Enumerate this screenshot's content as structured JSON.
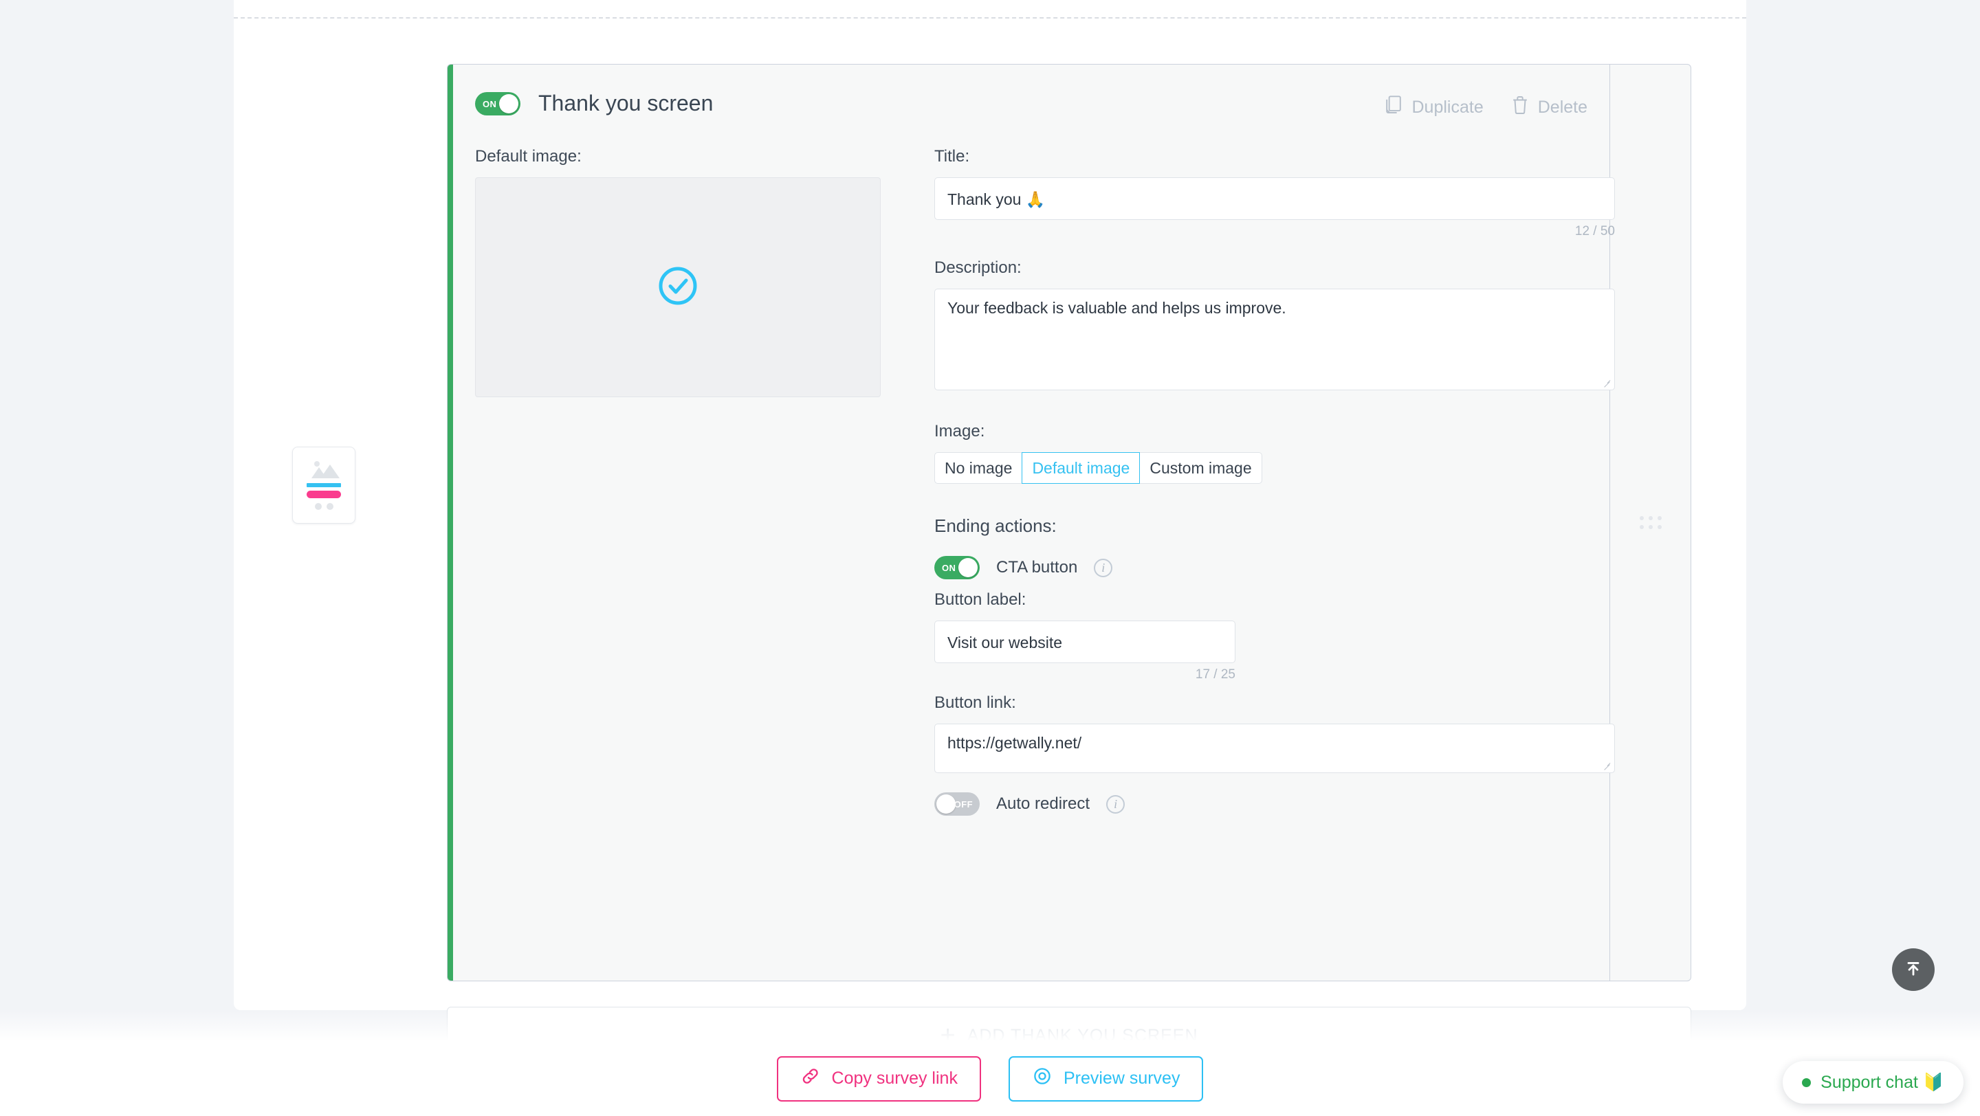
{
  "card": {
    "enabled_toggle_label": "ON",
    "title": "Thank you screen",
    "duplicate_label": "Duplicate",
    "delete_label": "Delete"
  },
  "preview": {
    "label": "Default image:",
    "icon": "check-circle-icon",
    "icon_color": "#2ec4f6"
  },
  "fields": {
    "title_label": "Title:",
    "title_value": "Thank you 🙏",
    "title_counter": "12 / 50",
    "description_label": "Description:",
    "description_value": "Your feedback is valuable and helps us improve."
  },
  "image": {
    "label": "Image:",
    "options": [
      "No image",
      "Default image",
      "Custom image"
    ],
    "selected": "Default image",
    "accent": "#35c1f1"
  },
  "ending_actions": {
    "heading": "Ending actions:",
    "cta": {
      "toggle_label": "ON",
      "label": "CTA button",
      "info": "i"
    },
    "button_label_field": {
      "label": "Button label:",
      "value": "Visit our website",
      "counter": "17 / 25"
    },
    "button_link_field": {
      "label": "Button link:",
      "value": "https://getwally.net/"
    },
    "auto_redirect": {
      "toggle_label": "OFF",
      "label": "Auto redirect",
      "info": "i"
    }
  },
  "add_card": {
    "plus": "+",
    "label": "ADD THANK YOU SCREEN"
  },
  "bottom_bar": {
    "copy_link_label": "Copy survey link",
    "preview_label": "Preview survey",
    "copy_link_color": "#f0317f",
    "preview_color": "#2cc0f4"
  },
  "support": {
    "label": "Support chat 🔰",
    "status_color": "#2aa84f"
  }
}
